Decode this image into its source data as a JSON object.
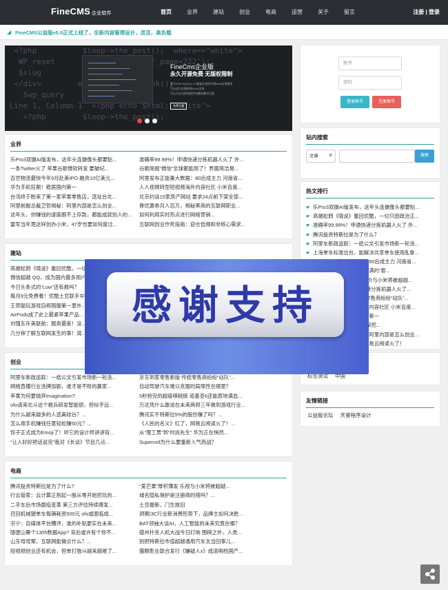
{
  "header": {
    "logo": "FineCMS",
    "logo_sub": "企业软件",
    "nav": [
      "首页",
      "业界",
      "建站",
      "创业",
      "电商",
      "运营",
      "关于",
      "留言"
    ],
    "auth": "注册 | 登录"
  },
  "notice": "FineCMS公益版v5.0正式上线了，全新内容管理设计，灵活，高负载",
  "banner": {
    "title": "FineCms企业版",
    "subtitle": "永久开源免费 无版权限制",
    "desc": [
      "基于PHP+MySQL+CI框架开发的开源Web应用程序",
      "可以运行在微软和Linux主机",
      "可以为企业网站提供完美的解决方案"
    ],
    "button": "免费下载"
  },
  "sections": [
    {
      "title": "业界",
      "items": [
        "乐Pro3双摄AI版发布，这年头连摄像头都要贴...",
        "准确率99.99%！申通快递分拣机器人火了 外...",
        "一条Twitter火了 苹果谷歌微软转发 要破纪...",
        "谷歌简报“微信”全球都能用了！界面简洁易...",
        "百世物流最快今年9月赴美IPO 融资10亿美元...",
        "阿里发布正能量大数据：80后成主力 河南省...",
        "华为手机狂飙！稳居国内第一",
        "人人视频转型短视频海外内容社区 小米百度...",
        "台湾终于盼来了第一家苹果零售店，选址台北...",
        "北京约谈15家房产网站 要求24点前下架全部...",
        "阿里前副总裁卫哲揭秘：阿里内部是怎么创业...",
        "靠优惠券月入百万，揭秘黑商的互联网职业...",
        "这年头，你赚钱的速度跟不上存款，都能成就别人的...",
        "如何利用实时热点进行网络营销...",
        "雷军当年竟这样创办小米，47岁也要如何度过...",
        "互联网创业作死指南：迎合低频和非核心需求..."
      ]
    },
    {
      "title": "建站",
      "items": [
        "高端松鸦《晓说》重回优酷，一切只因政治正...",
        "高端松鸦《晓说》重回优酷，一切只因政治正...",
        "微信超越 QQ，成为国内最多用户的...",
        "上海单车标准出台，能解决共享单车使用乱象...",
        "今日头条式的“Low”还有救吗？",
        "阿里发布正能量大数据：80后成主力 河南省...",
        "每月9元免费看！优酷土豆联手中...",
        "天猫，美联卡，背后是满满的“套...",
        "王思聪玩游戏自称国服第一意外...",
        "iPhone8真机首曝光：售价与小米将被超越...",
        "AirPods成了史上最紧苹果产品...",
        "准确率99.99%！申通快递分拣机器人火了 外...",
        "刘强东斥美联航：服务最差！没...",
        "人人视频转型短视频海外内容社区 小米百度...",
        "几分钟了解互联网发生的事！润...",
        "2000成本月入6000元？深挖..."
      ]
    },
    {
      "title": "创业",
      "items": [
        "阿里车新政追踪：一纸公文引发市场新一轮洗...",
        "京东到家零售新版 传统零售商纷纷“站队”...",
        "网络直播行业洗牌加剧，谁才是不败的赢家...",
        "自动驾驶汽车难以克服的局限性在哪里？",
        "苹果为何要抛弃Imagination?",
        "5秒抢完的超级棋桃链 诺基亚6还能原地满血...",
        "ofo请来北斗这个救兵研发智能锁，但似乎远...",
        "万达凭什么敢说在未来两到三年做到游戏行业...",
        "为什么越来越多的人选离硅谷？...",
        "腾讯实干特斯拉5%的股份赚了吗？...",
        "怎么用手机赚钱任意轻松赚50元？...",
        "《人民的名义》红了，网易云阅读火了！...",
        "饺子正式成为Emoji了！听它的设计师讲讲背...",
        "从“理工男”到“时尚先生” 华为正在悄然...",
        "“让人好好把话说完”我对《长谈》节目几点...",
        "Supercell为什么要重新入气而战？"
      ]
    },
    {
      "title": "电商",
      "items": [
        "腾讯投资特斯拉是为了什么?",
        "“爱芒果”厚积薄发 乐视与小米将被超越...",
        "行云管家：云计算正割起一股从零开始挖坑的...",
        "域名隐私保护是注册商的错吗？...",
        "二手车后市场面临变革 第三方评估持续爆发...",
        "土豆履新，门生故旧",
        "召回机械键单车每辆耗资500元 ofo或面临成...",
        "洞察|3C行业新消费形势下，品牌主如何决胜...",
        "宗宁：自媒体平台糟评，谁的补贴更实在未来...",
        "BAT领袖大谈AI，人工智能的未来究竟在哪？",
        "随便山寨个1305数据App? 背后或许有个你不...",
        "德州扑克人机大战今日打响 围棋之外，人类...",
        "山东母母案，互联网能做点什么？...",
        "别把特斯拉市值超越通用汽车太当回事儿...",
        "短视频创业还有机会，但单打独斗越来越难了...",
        "猫眼影业联合发行《嫌疑人x》成清明档国产..."
      ]
    }
  ],
  "login": {
    "account": "账号",
    "password": "密码",
    "login_btn": "登录账号",
    "register_btn": "注册账号"
  },
  "search": {
    "title": "站内搜索",
    "select": "文章",
    "button": "搜索"
  },
  "hot": {
    "title": "热文排行",
    "items": [
      "乐Pro3双摄AI版发布，这年头连摄像头都要贴...",
      "高端松鸦《晓说》重回优酷，一切只因政治正...",
      "准确率99.99%！申通快递分拣机器人火了 外...",
      "腾讯投资特斯拉是为了什么？",
      "阿里车新政追踪：一纸公文引发市场新一轮洗...",
      "上海单车标准出台，能解决共享单车使用乱象...",
      "阿里发布正能量大数据：80后成主力 河南省...",
      "天猫，美联卡，背后是满满的“套...",
      "iPhone8真机首曝光：售价与小米将被超越...",
      "准确率99.99%！申通快递分拣机器人火了...",
      "京东到家零售新版 传统零售商纷纷“站队”...",
      "人人视频转型短视频海外内容社区 小米百度...",
      "华为手机狂飙！稳居国内第一",
      "2000成本月入6000元？深挖...",
      "阿里前副总裁卫哲揭秘：阿里内部是怎么创业...",
      "《人民的名义》红了，网易云阅读火了！"
    ]
  },
  "tags": {
    "items": [
      "标签测试",
      "中国"
    ]
  },
  "friends": {
    "title": "友情链接",
    "items": [
      "公益版论坛",
      "天睿程序设计"
    ]
  },
  "overlay": "感谢支持"
}
